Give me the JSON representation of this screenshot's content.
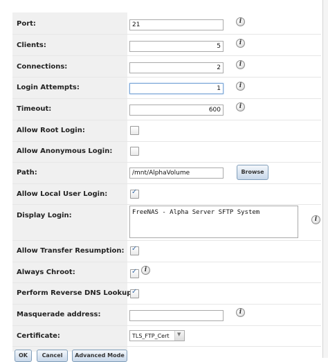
{
  "form": {
    "port": {
      "label": "Port:",
      "value": "21"
    },
    "clients": {
      "label": "Clients:",
      "value": "5"
    },
    "connections": {
      "label": "Connections:",
      "value": "2"
    },
    "login_attempts": {
      "label": "Login Attempts:",
      "value": "1"
    },
    "timeout": {
      "label": "Timeout:",
      "value": "600"
    },
    "allow_root_login": {
      "label": "Allow Root Login:",
      "checked": false
    },
    "allow_anonymous_login": {
      "label": "Allow Anonymous Login:",
      "checked": false
    },
    "path": {
      "label": "Path:",
      "value": "/mnt/AlphaVolume",
      "browse_label": "Browse"
    },
    "allow_local_user_login": {
      "label": "Allow Local User Login:",
      "checked": true
    },
    "display_login": {
      "label": "Display Login:",
      "value": "FreeNAS - Alpha Server SFTP System"
    },
    "allow_transfer_resumption": {
      "label": "Allow Transfer Resumption:",
      "checked": true
    },
    "always_chroot": {
      "label": "Always Chroot:",
      "checked": true
    },
    "reverse_dns": {
      "label": "Perform Reverse DNS Lookups:",
      "checked": true
    },
    "masquerade": {
      "label": "Masquerade address:",
      "value": ""
    },
    "certificate": {
      "label": "Certificate:",
      "value": "TLS_FTP_Cert"
    }
  },
  "buttons": {
    "ok": "OK",
    "cancel": "Cancel",
    "advanced": "Advanced Mode"
  },
  "icons": {
    "info": "info-icon",
    "checkmark": "check-icon",
    "dropdown": "chevron-down-icon"
  },
  "colors": {
    "label_bg": "#f0f0f0",
    "button_border": "#7f9db9",
    "check": "#3e6fa8"
  }
}
